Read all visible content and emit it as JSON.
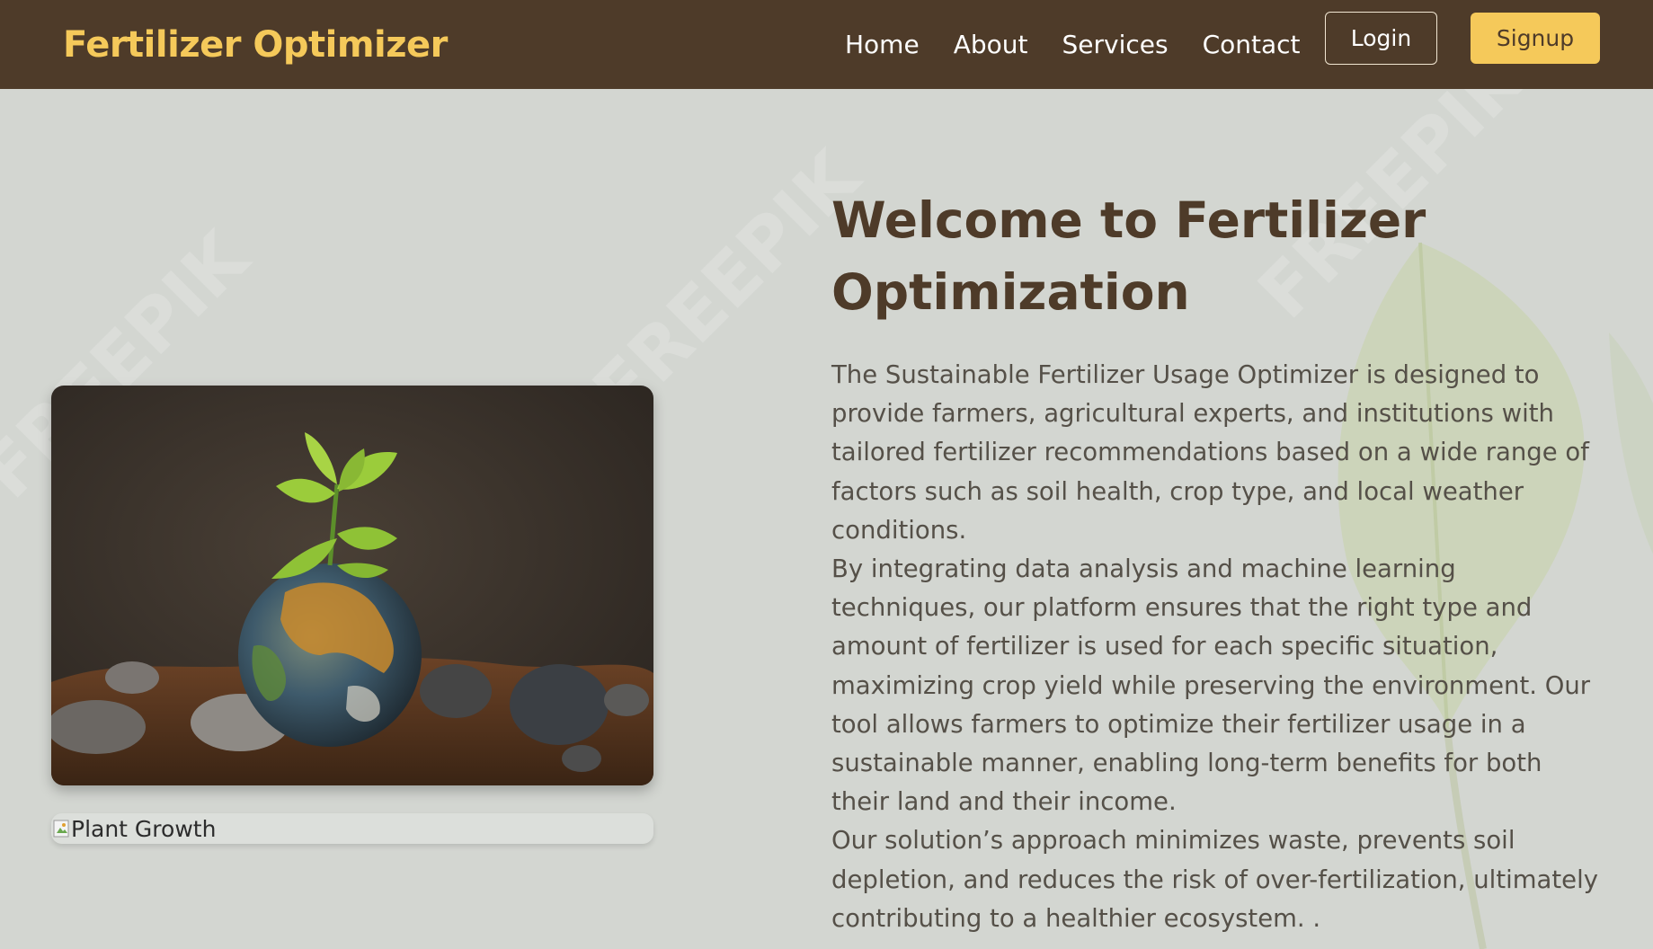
{
  "navbar": {
    "brand": "Fertilizer Optimizer",
    "links": [
      "Home",
      "About",
      "Services",
      "Contact"
    ],
    "login_label": "Login",
    "signup_label": "Signup"
  },
  "watermark_text": "FREEPIK",
  "hero": {
    "title": "Welcome to Fertilizer Optimization",
    "paragraphs": [
      "The Sustainable Fertilizer Usage Optimizer is designed to provide farmers, agricultural experts, and institutions with tailored fertilizer recommendations based on a wide range of factors such as soil health, crop type, and local weather conditions.",
      "By integrating data analysis and machine learning techniques, our platform ensures that the right type and amount of fertilizer is used for each specific situation, maximizing crop yield while preserving the environment. Our tool allows farmers to optimize their fertilizer usage in a sustainable manner, enabling long-term benefits for both their land and their income.",
      "Our solution’s approach minimizes waste, prevents soil depletion, and reduces the risk of over-fertilization, ultimately contributing to a healthier ecosystem. ."
    ],
    "broken_image_alt": "Plant Growth"
  },
  "colors": {
    "nav_bg": "#4e3b29",
    "accent": "#f5c95a",
    "page_bg": "#d3d6d1",
    "title": "#4e3b29",
    "body_text": "#555048"
  }
}
